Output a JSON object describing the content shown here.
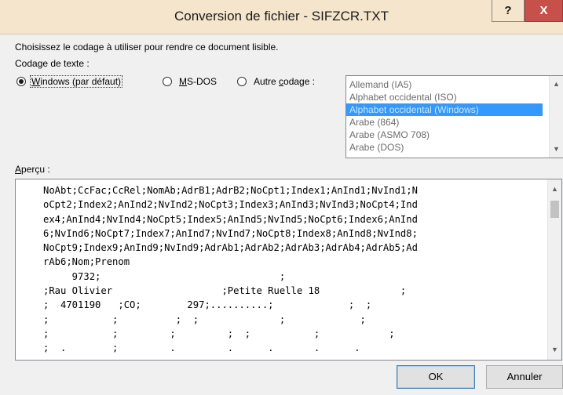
{
  "window": {
    "title": "Conversion de fichier - SIFZCR.TXT",
    "help_label": "?",
    "close_label": "X"
  },
  "instruction": "Choisissez le codage à utiliser pour rendre ce document lisible.",
  "encoding_group_label": "Codage de texte :",
  "radios": {
    "windows": {
      "label_key": "W",
      "label_rest": "indows (par défaut)",
      "checked": true
    },
    "msdos": {
      "label_key": "M",
      "label_rest": "S-DOS",
      "checked": false
    },
    "other": {
      "label_pre": "Autre ",
      "label_key": "c",
      "label_rest": "odage :",
      "checked": false
    }
  },
  "encodings": {
    "items": [
      "Allemand (IA5)",
      "Alphabet occidental (ISO)",
      "Alphabet occidental (Windows)",
      "Arabe (864)",
      "Arabe (ASMO 708)",
      "Arabe (DOS)"
    ],
    "selected": "Alphabet occidental (Windows)"
  },
  "preview": {
    "label_key": "A",
    "label_rest": "perçu :",
    "lines": [
      "NoAbt;CcFac;CcRel;NomAb;AdrB1;AdrB2;NoCpt1;Index1;AnInd1;NvInd1;N",
      "oCpt2;Index2;AnInd2;NvInd2;NoCpt3;Index3;AnInd3;NvInd3;NoCpt4;Ind",
      "ex4;AnInd4;NvInd4;NoCpt5;Index5;AnInd5;NvInd5;NoCpt6;Index6;AnInd",
      "6;NvInd6;NoCpt7;Index7;AnInd7;NvInd7;NoCpt8;Index8;AnInd8;NvInd8;",
      "NoCpt9;Index9;AnInd9;NvInd9;AdrAb1;AdrAb2;AdrAb3;AdrAb4;AdrAb5;Ad",
      "rAb6;Nom;Prenom",
      "     9732;                               ;",
      ";Rau Olivier                   ;Petite Ruelle 18              ;",
      ";  4701190   ;CO;        297;..........;             ;  ;",
      ";           ;          ;  ;              ;             ;",
      ";           ;         ;         ;  ;           ;            ;",
      ";  .        ;         .         .      .       .      ."
    ]
  },
  "buttons": {
    "ok": "OK",
    "cancel": "Annuler"
  }
}
